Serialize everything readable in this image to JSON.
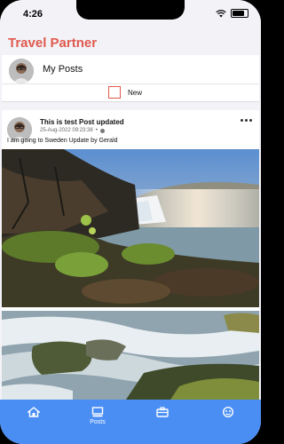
{
  "status_bar": {
    "time": "4:26"
  },
  "app": {
    "title": "Travel Partner"
  },
  "my_posts": {
    "label": "My Posts",
    "new_label": "New"
  },
  "post": {
    "title": "This is test Post updated",
    "date": "25-Aug-2022 09:23:38",
    "separator": "•",
    "text": "I am going to Sweden Update by Gerald"
  },
  "tabs": [
    {
      "label": "",
      "icon": "home-icon"
    },
    {
      "label": "Posts",
      "icon": "posts-icon"
    },
    {
      "label": "",
      "icon": "briefcase-icon"
    },
    {
      "label": "",
      "icon": "profile-icon"
    }
  ],
  "colors": {
    "accent": "#e05a4e",
    "tabbar": "#4a8ef4",
    "background": "#f2f2f7"
  }
}
